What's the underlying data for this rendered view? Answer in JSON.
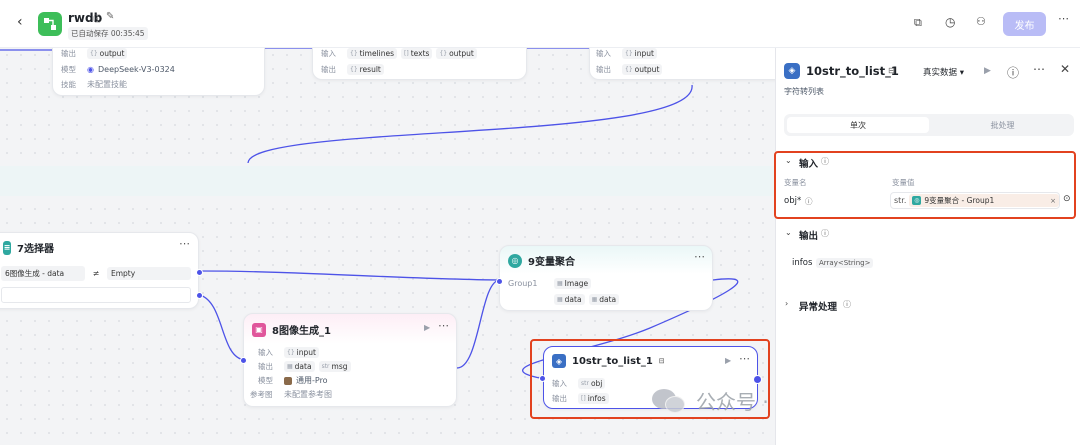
{
  "header": {
    "app_name": "rwdb",
    "autosave": "已自动保存 00:35:45",
    "publish": "发布"
  },
  "nodes": {
    "llm": {
      "out_label": "输出",
      "out_val": "output",
      "model_label": "模型",
      "model_val": "DeepSeek-V3-0324",
      "skill_label": "技能",
      "skill_val": "未配置技能"
    },
    "text": {
      "in_label": "输入",
      "in_vals": [
        "timelines",
        "texts",
        "output"
      ],
      "out_label": "输出",
      "out_val": "result"
    },
    "right": {
      "in_label": "输入",
      "in_val": "input",
      "out_label": "输出",
      "out_val": "output"
    },
    "selector": {
      "title": "7选择器",
      "cond_left": "6图像生成 - data",
      "op": "≠",
      "cond_right": "Empty"
    },
    "agg": {
      "title": "9变量聚合",
      "group": "Group1",
      "vals": [
        "Image",
        "data",
        "data"
      ]
    },
    "img": {
      "title": "8图像生成_1",
      "in_label": "输入",
      "in_val": "input",
      "out_label": "输出",
      "out_vals": [
        "data",
        "msg"
      ],
      "model_label": "模型",
      "model_val": "通用-Pro",
      "ref_label": "参考图",
      "ref_val": "未配置参考图"
    },
    "str": {
      "title": "10str_to_list_1",
      "in_label": "输入",
      "in_val": "obj",
      "out_label": "输出",
      "out_val": "infos"
    }
  },
  "panel": {
    "title": "10str_to_list_1",
    "data_mode": "真实数据",
    "subtitle": "字符转列表",
    "tabs": [
      "单次",
      "批处理"
    ],
    "input_section": "输入",
    "col_name": "变量名",
    "col_value": "变量值",
    "var_name": "obj*",
    "var_type": "str.",
    "var_value": "9变量聚合 - Group1",
    "output_section": "输出",
    "out_name": "infos",
    "out_type": "Array<String>",
    "error_section": "异常处理"
  },
  "watermark": "公众号 · 杰克船长的AIGC",
  "colors": {
    "accent": "#4d53e8",
    "highlight": "#e2421f",
    "brand": "#3dbe59"
  }
}
